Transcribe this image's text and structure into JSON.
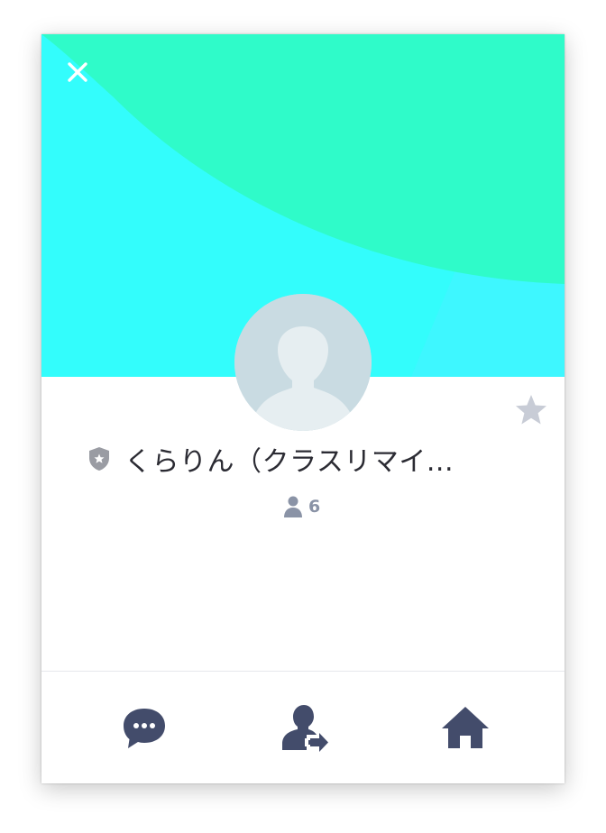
{
  "group": {
    "name": "くらりん（クラスリマイ...",
    "member_count": "6"
  },
  "icons": {
    "close": "close-icon",
    "favorite": "star-icon",
    "official": "shield-star-icon",
    "members": "person-icon",
    "chat": "chat-bubble-icon",
    "leave": "person-exit-icon",
    "home": "home-icon"
  },
  "colors": {
    "cover_cyan": "#33fdfc",
    "cover_green": "#2ffbc9",
    "icon_dark": "#434c6b",
    "star_gray": "#c8ccd6"
  }
}
